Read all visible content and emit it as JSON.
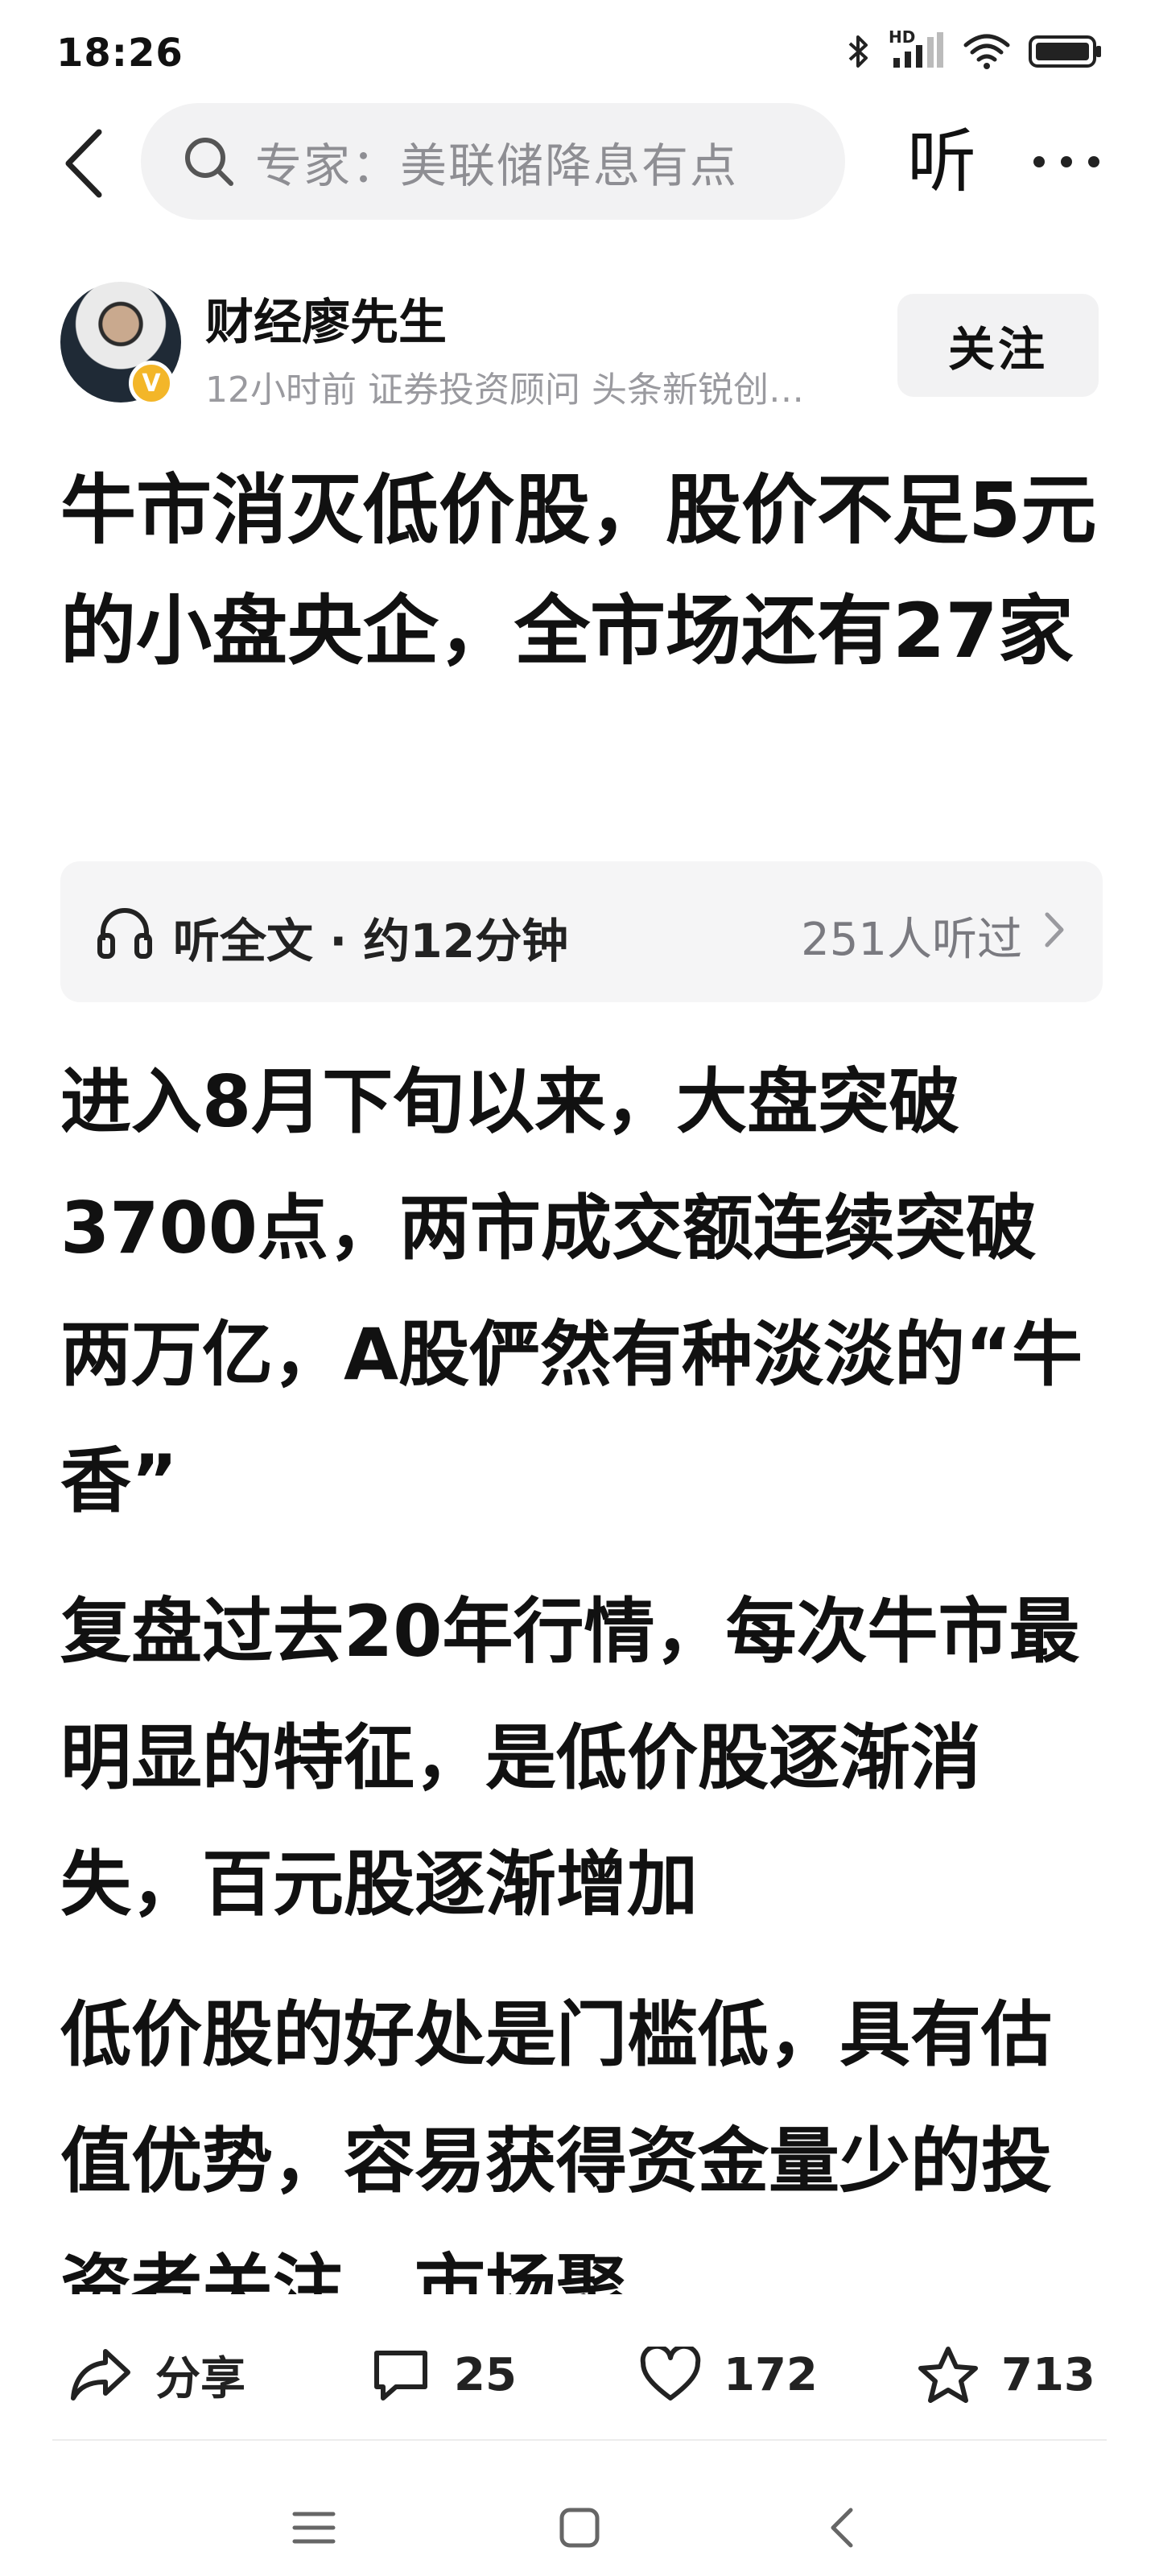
{
  "status_bar": {
    "time": "18:26",
    "signal_badge": "HD",
    "icons": [
      "bluetooth-icon",
      "cellular-signal-icon",
      "wifi-icon",
      "battery-icon"
    ]
  },
  "top_nav": {
    "search_placeholder": "专家：美联储降息有点",
    "listen_label": "听",
    "icons": [
      "back-arrow-icon",
      "search-icon",
      "more-dots-icon"
    ]
  },
  "author": {
    "name": "财经廖先生",
    "meta": "12小时前  证券投资顾问 头条新锐创…",
    "badge": "V",
    "follow_label": "关注"
  },
  "article": {
    "title": "牛市消灭低价股，股价不足5元的小盘央企，全市场还有27家",
    "listen": {
      "label": "听全文 · 约12分钟",
      "count": "251人听过"
    },
    "paragraphs": [
      "进入8月下旬以来，大盘突破3700点，两市成交额连续突破两万亿，A股俨然有种淡淡的“牛香”",
      "复盘过去20年行情，每次牛市最明显的特征，是低价股逐渐消失，百元股逐渐增加",
      "低价股的好处是门槛低，具有估值优势，容易获得资金量少的投资者关注，市场聚"
    ]
  },
  "actions": {
    "share_label": "分享",
    "comments": "25",
    "likes": "172",
    "favorites": "713"
  },
  "colors": {
    "text": "#111111",
    "muted": "#9a9a9f",
    "surface": "#f2f2f3",
    "badge": "#f3b629"
  }
}
